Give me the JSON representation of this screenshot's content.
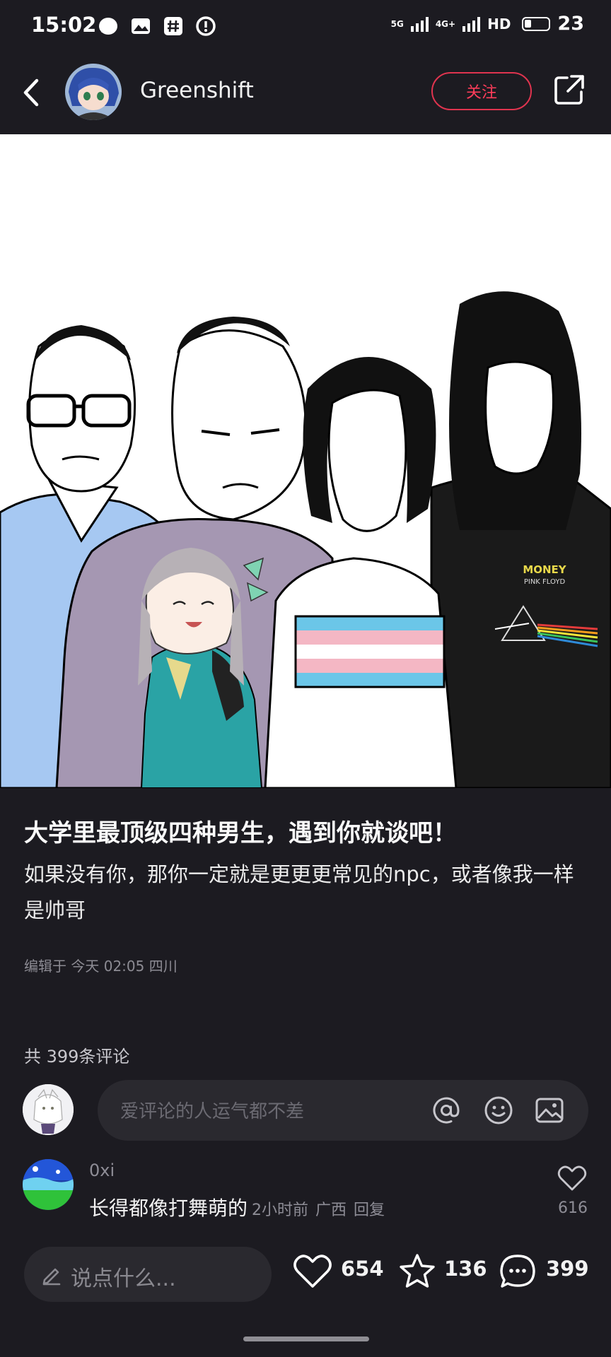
{
  "status_bar": {
    "time": "15:02",
    "network_1": "5G",
    "network_2": "4G+",
    "hd": "HD",
    "battery": "23"
  },
  "nav": {
    "author_name": "Greenshift",
    "follow_label": "关注"
  },
  "post": {
    "image_shirt_text_1": "MONEY",
    "image_shirt_text_2": "PINK FLOYD",
    "title": "大学里最顶级四种男生，遇到你就谈吧！",
    "body": "如果没有你，那你一定就是更更更常见的npc，或者像我一样是帅哥",
    "meta": "编辑于 今天 02:05 四川"
  },
  "comments": {
    "count_text": "共 399条评论",
    "input_placeholder": "爱评论的人运气都不差",
    "items": [
      {
        "user": "0xi",
        "text": "长得都像打舞萌的",
        "time": "2小时前",
        "region": "广西",
        "reply_label": "回复",
        "likes": "616"
      }
    ]
  },
  "bottom_bar": {
    "say_placeholder": "说点什么...",
    "like_count": "654",
    "collect_count": "136",
    "comment_count": "399"
  },
  "colors": {
    "background": "#1c1b21",
    "accent": "#ff3d5a",
    "muted_text": "#8e8d96"
  }
}
